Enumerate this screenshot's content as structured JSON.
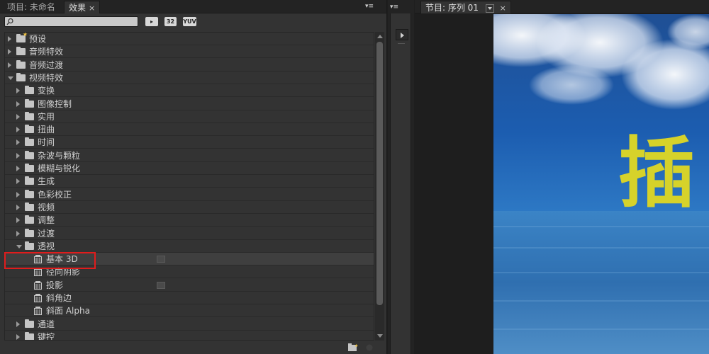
{
  "effects_panel": {
    "tabs": [
      {
        "label": "项目: 未命名"
      },
      {
        "label": "效果",
        "close": "×"
      }
    ],
    "search": {
      "value": "",
      "placeholder": ""
    },
    "toolbar": {
      "accelerated_label": "▸",
      "bit32_label": "32",
      "yuv_label": "YUV"
    },
    "tree": [
      {
        "label": "预设",
        "kind": "preset-folder",
        "level": 0,
        "expanded": false
      },
      {
        "label": "音频特效",
        "kind": "folder",
        "level": 0,
        "expanded": false
      },
      {
        "label": "音频过渡",
        "kind": "folder",
        "level": 0,
        "expanded": false
      },
      {
        "label": "视频特效",
        "kind": "folder",
        "level": 0,
        "expanded": true
      },
      {
        "label": "变换",
        "kind": "folder",
        "level": 1,
        "expanded": false
      },
      {
        "label": "图像控制",
        "kind": "folder",
        "level": 1,
        "expanded": false
      },
      {
        "label": "实用",
        "kind": "folder",
        "level": 1,
        "expanded": false
      },
      {
        "label": "扭曲",
        "kind": "folder",
        "level": 1,
        "expanded": false
      },
      {
        "label": "时间",
        "kind": "folder",
        "level": 1,
        "expanded": false
      },
      {
        "label": "杂波与颗粒",
        "kind": "folder",
        "level": 1,
        "expanded": false
      },
      {
        "label": "模糊与锐化",
        "kind": "folder",
        "level": 1,
        "expanded": false
      },
      {
        "label": "生成",
        "kind": "folder",
        "level": 1,
        "expanded": false
      },
      {
        "label": "色彩校正",
        "kind": "folder",
        "level": 1,
        "expanded": false
      },
      {
        "label": "视频",
        "kind": "folder",
        "level": 1,
        "expanded": false
      },
      {
        "label": "调整",
        "kind": "folder",
        "level": 1,
        "expanded": false
      },
      {
        "label": "过渡",
        "kind": "folder",
        "level": 1,
        "expanded": false
      },
      {
        "label": "透视",
        "kind": "folder",
        "level": 1,
        "expanded": true
      },
      {
        "label": "基本 3D",
        "kind": "effect",
        "level": 2,
        "accelerated": true,
        "selected": true
      },
      {
        "label": "径向阴影",
        "kind": "effect",
        "level": 2,
        "accelerated": false
      },
      {
        "label": "投影",
        "kind": "effect",
        "level": 2,
        "accelerated": true
      },
      {
        "label": "斜角边",
        "kind": "effect",
        "level": 2,
        "accelerated": false
      },
      {
        "label": "斜面 Alpha",
        "kind": "effect",
        "level": 2,
        "accelerated": false
      },
      {
        "label": "通道",
        "kind": "folder",
        "level": 1,
        "expanded": false
      },
      {
        "label": "键控",
        "kind": "folder",
        "level": 1,
        "expanded": false
      }
    ],
    "highlight_color": "#e01c1c"
  },
  "program_panel": {
    "tab_label": "节目: 序列 01",
    "close": "×",
    "overlay_char": "插",
    "overlay_color": "#d6d22a"
  }
}
